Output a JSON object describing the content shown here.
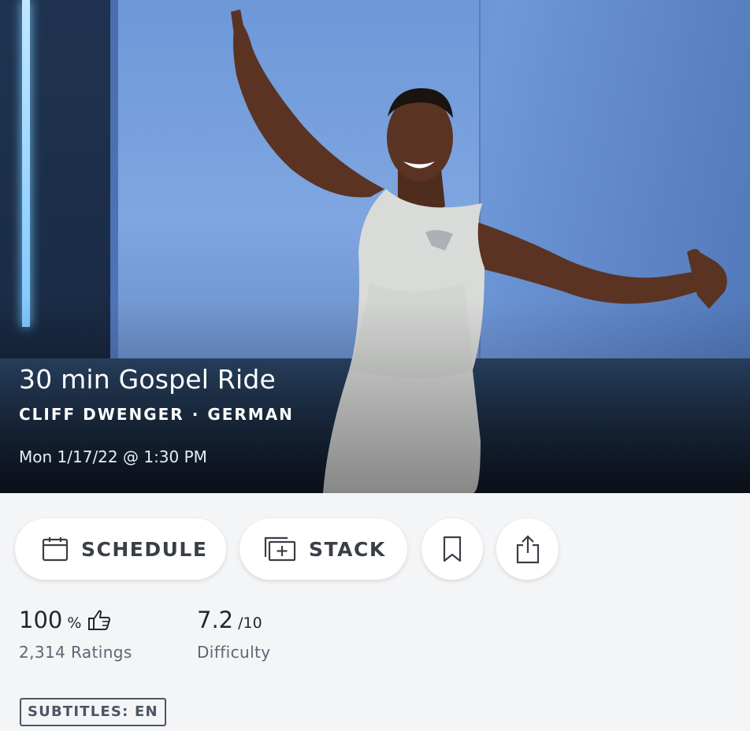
{
  "class": {
    "title": "30 min Gospel Ride",
    "instructor": "CLIFF DWENGER",
    "separator": "·",
    "language": "GERMAN",
    "datetime": "Mon 1/17/22 @ 1:30 PM"
  },
  "actions": {
    "schedule_label": "SCHEDULE",
    "stack_label": "STACK",
    "icons": {
      "schedule": "calendar-icon",
      "stack": "stack-add-icon",
      "bookmark": "bookmark-icon",
      "share": "share-icon"
    }
  },
  "stats": {
    "rating_value": "100",
    "rating_unit": "%",
    "rating_icon": "thumbs-up-icon",
    "ratings_count": "2,314 Ratings",
    "difficulty_value": "7.2",
    "difficulty_unit": "/10",
    "difficulty_label": "Difficulty"
  },
  "badge": {
    "subtitles": "SUBTITLES: EN"
  },
  "colors": {
    "background": "#f4f5f7",
    "text_primary": "#222831",
    "text_secondary": "#5d6673",
    "hero_blue": "#5c83c9"
  }
}
